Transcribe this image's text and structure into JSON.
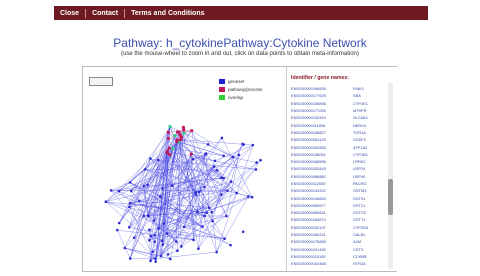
{
  "nav": {
    "items": [
      "Close",
      "Contact",
      "Terms and Conditions"
    ]
  },
  "title": "Pathway: h_cytokinePathway:Cytokine Network",
  "subtitle": "(use the mouse-wheel to zoom in and out, click on data points to obtain meta-information)",
  "legend": [
    {
      "label": "geneset",
      "color": "#1f1fd6"
    },
    {
      "label": "pathway/process",
      "color": "#c2185b"
    },
    {
      "label": "overlap",
      "color": "#33cc33"
    }
  ],
  "identifiers": {
    "header": "Identifier / gene names:",
    "rows": [
      {
        "code": "ENSG00000166839",
        "name": "FINK1"
      },
      {
        "code": "ENSG00000177629",
        "name": "SBA"
      },
      {
        "code": "ENSG00000108846",
        "name": "CYP2E1"
      },
      {
        "code": "ENSG00000177000",
        "name": "MTHFR"
      },
      {
        "code": "ENSG00000142319",
        "name": "SLC6A3"
      },
      {
        "code": "ENSG00000111658",
        "name": "NEDD4"
      },
      {
        "code": "ENSG00000108827",
        "name": "TOR1A"
      },
      {
        "code": "ENSG00000054129",
        "name": "GSDF2"
      },
      {
        "code": "ENSG00000160563",
        "name": "ATP1A2"
      },
      {
        "code": "ENSG00000138061",
        "name": "CYP1B1"
      },
      {
        "code": "ENSG00000168596",
        "name": "LRRK2"
      },
      {
        "code": "ENSG00000153443",
        "name": "USP24"
      },
      {
        "code": "ENSG00000068882",
        "name": "USP40"
      },
      {
        "code": "ENSG00000112530",
        "name": "PACRG"
      },
      {
        "code": "ENSG00000134202",
        "name": "GSTM3"
      },
      {
        "code": "ENSG00000148834",
        "name": "GST01"
      },
      {
        "code": "ENSG00000065577",
        "name": "GST21"
      },
      {
        "code": "ENSG00000065621",
        "name": "GSTO2"
      },
      {
        "code": "ENSG00000184674",
        "name": "GSTT1"
      },
      {
        "code": "ENSG00000100197",
        "name": "CYP2D6"
      },
      {
        "code": "ENSG00000160221",
        "name": "CALB1"
      },
      {
        "code": "ENSG00000175899",
        "name": "A2M"
      },
      {
        "code": "ENSG00000101439",
        "name": "CST3"
      },
      {
        "code": "ENSG00000115165",
        "name": "CCKBR"
      },
      {
        "code": "ENSG00000102468",
        "name": "HTR2A"
      }
    ]
  }
}
